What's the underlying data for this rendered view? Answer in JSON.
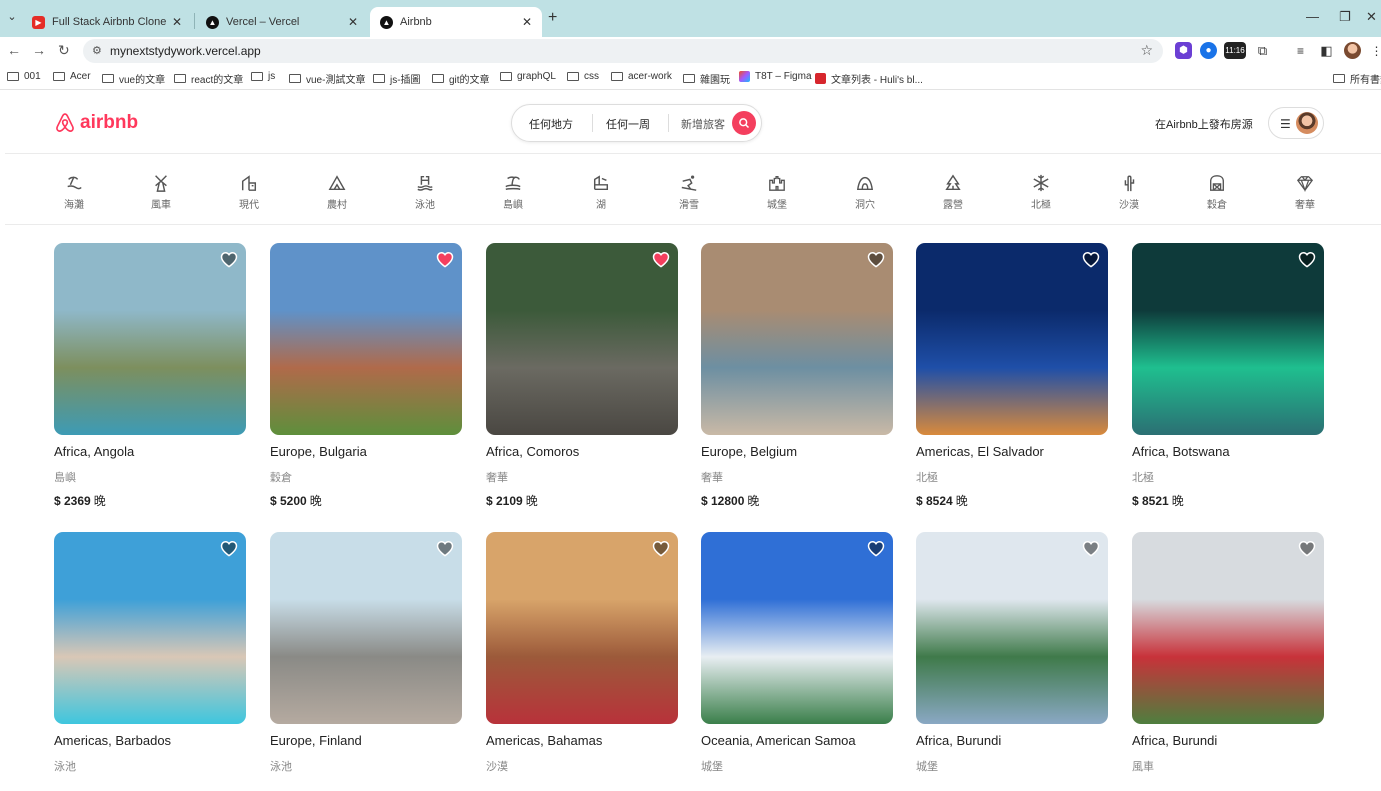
{
  "browser": {
    "tabs": [
      {
        "title": "Full Stack Airbnb Clone with I",
        "icon": "youtube-icon",
        "active": false
      },
      {
        "title": "Vercel – Vercel",
        "icon": "vercel-icon",
        "active": false
      },
      {
        "title": "Airbnb",
        "icon": "vercel-icon",
        "active": true
      }
    ],
    "url": "mynextstydywork.vercel.app",
    "ext_badge": "11:16",
    "bookmarks": [
      {
        "label": "001",
        "type": "folder"
      },
      {
        "label": "Acer",
        "type": "folder"
      },
      {
        "label": "vue的文章",
        "type": "folder"
      },
      {
        "label": "react的文章",
        "type": "folder"
      },
      {
        "label": "js",
        "type": "folder"
      },
      {
        "label": "vue-測試文章",
        "type": "folder"
      },
      {
        "label": "js-插圖",
        "type": "folder"
      },
      {
        "label": "git的文章",
        "type": "folder"
      },
      {
        "label": "graphQL",
        "type": "folder"
      },
      {
        "label": "css",
        "type": "folder"
      },
      {
        "label": "acer-work",
        "type": "folder"
      },
      {
        "label": "雜園玩",
        "type": "folder"
      },
      {
        "label": "T8T – Figma",
        "type": "figma"
      },
      {
        "label": "文章列表 - Huli's bl...",
        "type": "site"
      }
    ],
    "all_bookmarks": "所有書籤"
  },
  "header": {
    "logo": "airbnb",
    "search": {
      "anywhere": "任何地方",
      "anyweek": "任何一周",
      "guests": "新增旅客"
    },
    "host_link": "在Airbnb上發布房源"
  },
  "categories": [
    {
      "label": "海灘",
      "icon": "beach-icon"
    },
    {
      "label": "風車",
      "icon": "windmill-icon"
    },
    {
      "label": "現代",
      "icon": "modern-icon"
    },
    {
      "label": "農村",
      "icon": "countryside-icon"
    },
    {
      "label": "泳池",
      "icon": "pool-icon"
    },
    {
      "label": "島嶼",
      "icon": "island-icon"
    },
    {
      "label": "湖",
      "icon": "lake-icon"
    },
    {
      "label": "滑雪",
      "icon": "skiing-icon"
    },
    {
      "label": "城堡",
      "icon": "castle-icon"
    },
    {
      "label": "洞穴",
      "icon": "cave-icon"
    },
    {
      "label": "露營",
      "icon": "camping-icon"
    },
    {
      "label": "北極",
      "icon": "arctic-icon"
    },
    {
      "label": "沙漠",
      "icon": "desert-icon"
    },
    {
      "label": "穀倉",
      "icon": "barn-icon"
    },
    {
      "label": "奢華",
      "icon": "lux-icon"
    }
  ],
  "listings": [
    {
      "location": "Africa, Angola",
      "category": "島嶼",
      "price": "$ 2369",
      "unit": "晚",
      "favorite": false,
      "colors": [
        "#8fb8c9",
        "#7d8f5e",
        "#3d9bb5"
      ]
    },
    {
      "location": "Europe, Bulgaria",
      "category": "穀倉",
      "price": "$ 5200",
      "unit": "晚",
      "favorite": true,
      "colors": [
        "#5f92c9",
        "#b06a4a",
        "#5e8f3c"
      ]
    },
    {
      "location": "Africa, Comoros",
      "category": "奢華",
      "price": "$ 2109",
      "unit": "晚",
      "favorite": true,
      "colors": [
        "#3c5a3a",
        "#6b6a62",
        "#4a4742"
      ]
    },
    {
      "location": "Europe, Belgium",
      "category": "奢華",
      "price": "$ 12800",
      "unit": "晚",
      "favorite": false,
      "colors": [
        "#a98c72",
        "#6d8fa2",
        "#c9b9a6"
      ]
    },
    {
      "location": "Americas, El Salvador",
      "category": "北極",
      "price": "$ 8524",
      "unit": "晚",
      "favorite": false,
      "colors": [
        "#0b2a6b",
        "#1f4fa8",
        "#d98a3c"
      ]
    },
    {
      "location": "Africa, Botswana",
      "category": "北極",
      "price": "$ 8521",
      "unit": "晚",
      "favorite": false,
      "colors": [
        "#0e3a3a",
        "#1fbf8f",
        "#2b6f73"
      ]
    },
    {
      "location": "Americas, Barbados",
      "category": "泳池",
      "price": "",
      "unit": "",
      "favorite": false,
      "colors": [
        "#3ea0d8",
        "#d9c7b6",
        "#3ec6de"
      ]
    },
    {
      "location": "Europe, Finland",
      "category": "泳池",
      "price": "",
      "unit": "",
      "favorite": false,
      "colors": [
        "#c8dde8",
        "#8a8a86",
        "#b5aaa0"
      ]
    },
    {
      "location": "Americas, Bahamas",
      "category": "沙漠",
      "price": "",
      "unit": "",
      "favorite": false,
      "colors": [
        "#d8a46a",
        "#9c5a3a",
        "#b8323a"
      ]
    },
    {
      "location": "Oceania, American Samoa",
      "category": "城堡",
      "price": "",
      "unit": "",
      "favorite": false,
      "colors": [
        "#2f6fd6",
        "#e8eef2",
        "#3a7f4a"
      ]
    },
    {
      "location": "Africa, Burundi",
      "category": "城堡",
      "price": "",
      "unit": "",
      "favorite": false,
      "colors": [
        "#dfe7ee",
        "#3f7a4a",
        "#8aa8c4"
      ]
    },
    {
      "location": "Africa, Burundi",
      "category": "風車",
      "price": "",
      "unit": "",
      "favorite": false,
      "colors": [
        "#d7dbdf",
        "#c8323a",
        "#4e7f3e"
      ]
    }
  ],
  "colors": {
    "brand": "#ff385c",
    "favorite": "#f43f5e"
  }
}
